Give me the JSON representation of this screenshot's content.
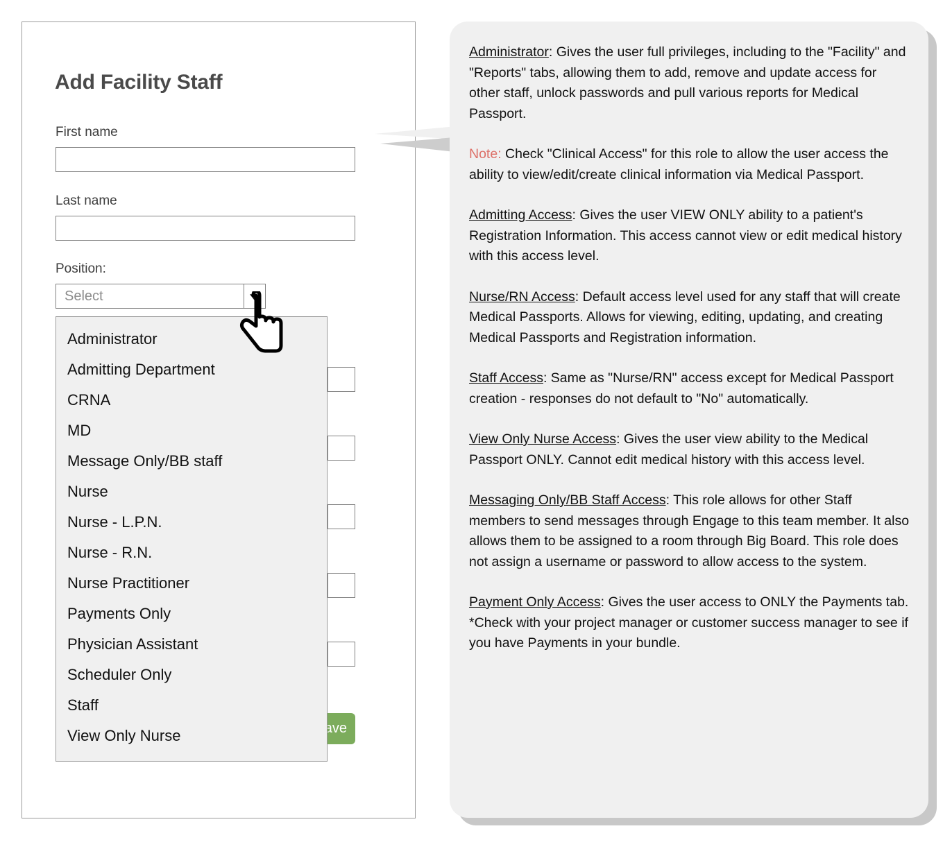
{
  "form": {
    "title": "Add Facility Staff",
    "fields": {
      "first_name_label": "First name",
      "first_name_value": "",
      "first_name_placeholder": "",
      "last_name_label": "Last name",
      "last_name_value": "",
      "last_name_placeholder": "",
      "position_label": "Position:",
      "position_selected": "Select"
    },
    "save_label": "Save",
    "save_color": "#7cac5c"
  },
  "position_dropdown": {
    "options": [
      "Administrator",
      "Admitting Department",
      "CRNA",
      "MD",
      "Message Only/BB staff",
      "Nurse",
      "Nurse - L.P.N.",
      "Nurse - R.N.",
      "Nurse Practitioner",
      "Payments Only",
      "Physician Assistant",
      "Scheduler Only",
      "Staff",
      "View Only Nurse"
    ]
  },
  "info_panel": {
    "note_color": "#dd7068",
    "paragraphs": [
      {
        "term": "Administrator",
        "body": ": Gives the user full privileges, including to the \"Facility\" and \"Reports\" tabs, allowing them to add, remove and update access for other staff, unlock passwords and pull various reports for Medical Passport."
      },
      {
        "note": "Note:",
        "body": " Check \"Clinical Access\" for this role to allow the user access the ability to view/edit/create clinical information via Medical Passport."
      },
      {
        "term": "Admitting Access",
        "body": ": Gives the user VIEW ONLY ability to a patient's Registration Information. This access cannot view or edit medical history with this access level."
      },
      {
        "term": "Nurse/RN Access",
        "body": ": Default access level used for any staff that will create Medical Passports. Allows for viewing, editing, updating, and creating Medical Passports and Registration information."
      },
      {
        "term": "Staff Access",
        "body": ": Same as \"Nurse/RN\" access except for Medical Passport creation - responses do not default to \"No\" automatically."
      },
      {
        "term": "View Only Nurse Access",
        "body": ": Gives the user view ability to the Medical Passport ONLY. Cannot edit medical history with this access level."
      },
      {
        "term": "Messaging Only/BB Staff Access",
        "body": ": This role allows for other Staff members to send messages through Engage to this team member. It also allows them to be assigned to a room through Big Board. This role does not assign a username or password to allow access to the system."
      },
      {
        "term": "Payment Only Access",
        "body": ": Gives the user access to ONLY the Payments tab.  *Check with your project manager or customer success manager to see if you have Payments in your bundle."
      }
    ]
  },
  "icons": {
    "dropdown_arrow": "chevron-down-icon",
    "cursor": "hand-pointer-cursor"
  }
}
